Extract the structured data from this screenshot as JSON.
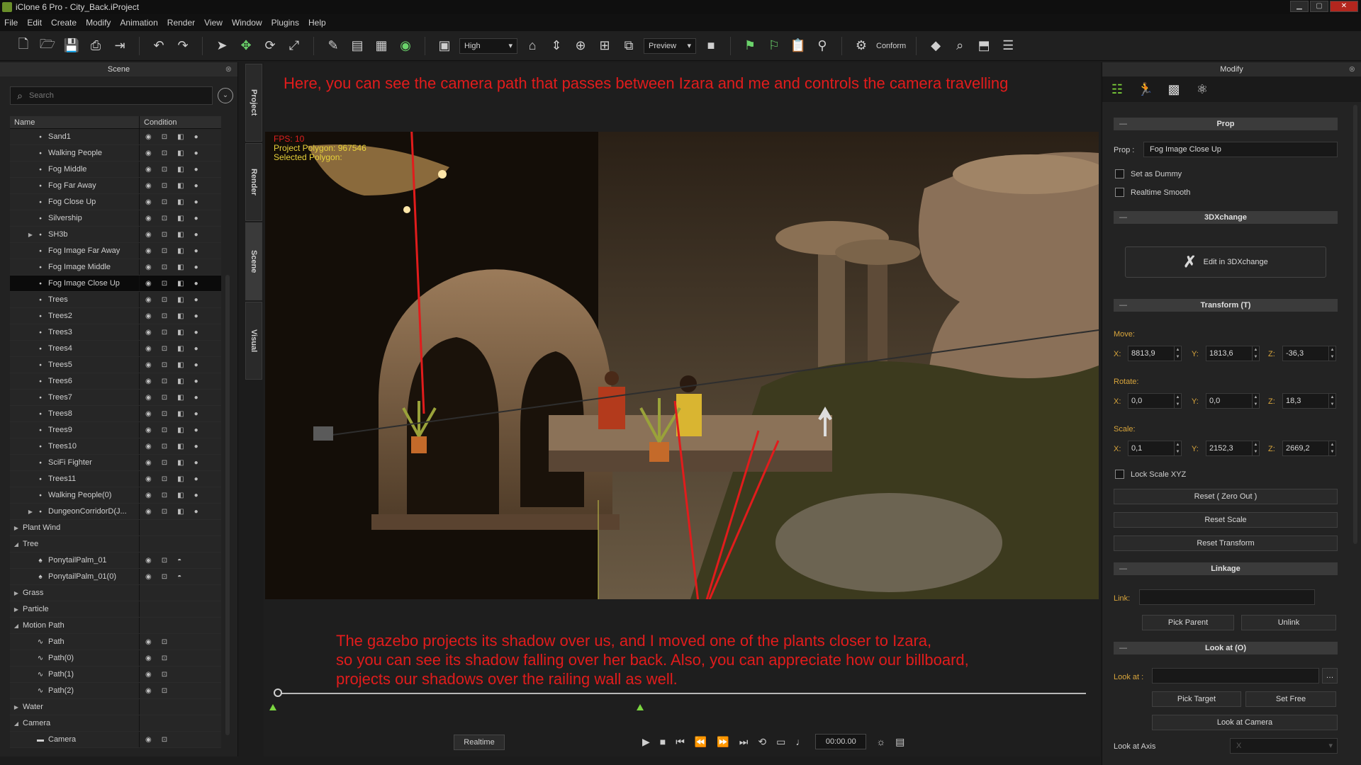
{
  "window": {
    "title": "iClone 6 Pro - City_Back.iProject"
  },
  "menu": [
    "File",
    "Edit",
    "Create",
    "Modify",
    "Animation",
    "Render",
    "View",
    "Window",
    "Plugins",
    "Help"
  ],
  "toolbar": {
    "quality": "High",
    "preview": "Preview",
    "conform": "Conform"
  },
  "scene_panel": {
    "title": "Scene",
    "search_placeholder": "Search",
    "col_name": "Name",
    "col_condition": "Condition",
    "rows": [
      {
        "label": "Sand1",
        "level": 2,
        "kind": "obj"
      },
      {
        "label": "Walking People",
        "level": 2,
        "kind": "obj"
      },
      {
        "label": "Fog Middle",
        "level": 2,
        "kind": "obj"
      },
      {
        "label": "Fog Far Away",
        "level": 2,
        "kind": "obj"
      },
      {
        "label": "Fog Close Up",
        "level": 2,
        "kind": "obj"
      },
      {
        "label": "Silvership",
        "level": 2,
        "kind": "obj"
      },
      {
        "label": "SH3b",
        "level": 2,
        "kind": "obj",
        "expander": "closed"
      },
      {
        "label": "Fog Image Far Away",
        "level": 2,
        "kind": "obj"
      },
      {
        "label": "Fog Image Middle",
        "level": 2,
        "kind": "obj"
      },
      {
        "label": "Fog Image Close Up",
        "level": 2,
        "kind": "obj",
        "selected": true
      },
      {
        "label": "Trees",
        "level": 2,
        "kind": "obj"
      },
      {
        "label": "Trees2",
        "level": 2,
        "kind": "obj"
      },
      {
        "label": "Trees3",
        "level": 2,
        "kind": "obj"
      },
      {
        "label": "Trees4",
        "level": 2,
        "kind": "obj"
      },
      {
        "label": "Trees5",
        "level": 2,
        "kind": "obj"
      },
      {
        "label": "Trees6",
        "level": 2,
        "kind": "obj"
      },
      {
        "label": "Trees7",
        "level": 2,
        "kind": "obj"
      },
      {
        "label": "Trees8",
        "level": 2,
        "kind": "obj"
      },
      {
        "label": "Trees9",
        "level": 2,
        "kind": "obj"
      },
      {
        "label": "Trees10",
        "level": 2,
        "kind": "obj"
      },
      {
        "label": "SciFi Fighter",
        "level": 2,
        "kind": "obj"
      },
      {
        "label": "Trees11",
        "level": 2,
        "kind": "obj"
      },
      {
        "label": "Walking People(0)",
        "level": 2,
        "kind": "obj"
      },
      {
        "label": "DungeonCorridorD(J...",
        "level": 2,
        "kind": "obj",
        "expander": "closed"
      },
      {
        "label": "Plant Wind",
        "level": 0,
        "kind": "group",
        "expander": "closed"
      },
      {
        "label": "Tree",
        "level": 0,
        "kind": "group",
        "expander": "open"
      },
      {
        "label": "PonytailPalm_01",
        "level": 2,
        "kind": "tree"
      },
      {
        "label": "PonytailPalm_01(0)",
        "level": 2,
        "kind": "tree"
      },
      {
        "label": "Grass",
        "level": 0,
        "kind": "group",
        "expander": "closed"
      },
      {
        "label": "Particle",
        "level": 0,
        "kind": "group",
        "expander": "closed"
      },
      {
        "label": "Motion Path",
        "level": 0,
        "kind": "group",
        "expander": "open"
      },
      {
        "label": "Path",
        "level": 2,
        "kind": "path"
      },
      {
        "label": "Path(0)",
        "level": 2,
        "kind": "path"
      },
      {
        "label": "Path(1)",
        "level": 2,
        "kind": "path"
      },
      {
        "label": "Path(2)",
        "level": 2,
        "kind": "path"
      },
      {
        "label": "Water",
        "level": 0,
        "kind": "group",
        "expander": "closed"
      },
      {
        "label": "Camera",
        "level": 0,
        "kind": "group",
        "expander": "open"
      },
      {
        "label": "Camera",
        "level": 2,
        "kind": "camera"
      }
    ]
  },
  "side_tabs": [
    "Project",
    "Render",
    "Scene",
    "Visual"
  ],
  "viewport": {
    "annotation_top": "Here, you can see the camera path that passes between Izara and me and controls the camera travelling",
    "annotation_bottom": [
      "The gazebo projects its shadow over us, and I moved one of the plants closer to Izara,",
      "so you can see its shadow falling over her back. Also, you can appreciate how our billboard,",
      "projects our shadows over the railing wall as well."
    ],
    "hud_fps": "FPS: 10",
    "hud_project_polygon": "Project Polygon: 967546",
    "hud_selected_polygon": "Selected Polygon:",
    "realtime": "Realtime",
    "time": "00:00.00"
  },
  "modify": {
    "title": "Modify",
    "prop_section": "Prop",
    "prop_label": "Prop :",
    "prop_value": "Fog Image Close Up",
    "set_as_dummy": "Set as Dummy",
    "realtime_smooth": "Realtime Smooth",
    "xchange_section": "3DXchange",
    "edit_3dxchange": "Edit in 3DXchange",
    "transform_section": "Transform  (T)",
    "move_label": "Move:",
    "rotate_label": "Rotate:",
    "scale_label": "Scale:",
    "axis_x": "X:",
    "axis_y": "Y:",
    "axis_z": "Z:",
    "move": {
      "x": "8813,9",
      "y": "1813,6",
      "z": "-36,3"
    },
    "rotate": {
      "x": "0,0",
      "y": "0,0",
      "z": "18,3"
    },
    "scale": {
      "x": "0,1",
      "y": "2152,3",
      "z": "2669,2"
    },
    "lock_scale": "Lock Scale XYZ",
    "reset_zero": "Reset ( Zero Out )",
    "reset_scale": "Reset Scale",
    "reset_transform": "Reset Transform",
    "linkage_section": "Linkage",
    "link_label": "Link:",
    "pick_parent": "Pick Parent",
    "unlink": "Unlink",
    "lookat_section": "Look at  (O)",
    "lookat_label": "Look at :",
    "pick_target": "Pick Target",
    "set_free": "Set Free",
    "lookat_camera": "Look at Camera",
    "lookat_axis": "Look at Axis",
    "lookat_axis_value": "X"
  }
}
